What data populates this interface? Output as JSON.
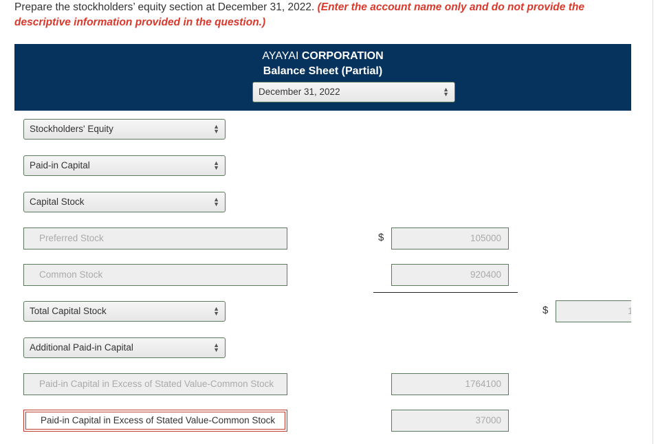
{
  "instruction": {
    "text": "Prepare the stockholders’ equity section at December 31, 2022. ",
    "emphasis": "(Enter the account name only and do not provide the descriptive information provided in the question.)"
  },
  "header": {
    "company_prefix": "AYAYAI ",
    "company_bold": "CORPORATION",
    "subtitle": "Balance Sheet (Partial)",
    "date_select": "December 31, 2022"
  },
  "rows": [
    {
      "label": "Stockholders' Equity"
    },
    {
      "label": "Paid-in Capital"
    },
    {
      "label": "Capital Stock"
    },
    {
      "label": "Preferred Stock",
      "amount": "105000",
      "currency": "$"
    },
    {
      "label": "Common Stock",
      "amount": "920400"
    },
    {
      "label": "Total Capital Stock",
      "amount": "1",
      "currency": "$"
    },
    {
      "label": "Additional Paid-in Capital"
    },
    {
      "label": "Paid-in Capital in Excess of Stated Value-Common Stock",
      "amount": "1764100"
    },
    {
      "label": "Paid-in Capital in Excess of Stated Value-Common Stock",
      "amount": "37000"
    }
  ]
}
